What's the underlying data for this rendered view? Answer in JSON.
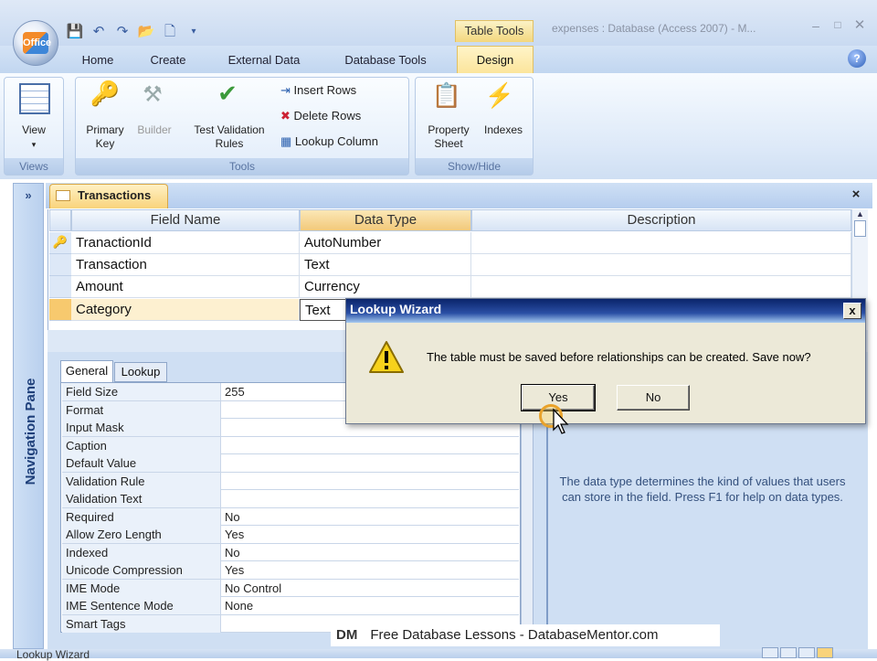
{
  "window": {
    "title": "expenses : Database (Access 2007) - M...",
    "context_tab_group": "Table Tools"
  },
  "office_button": {
    "logo": "Office"
  },
  "quick_access": [
    "save-icon",
    "undo-icon",
    "redo-icon",
    "open-icon",
    "new-icon",
    "customize-icon"
  ],
  "ribbon_tabs": [
    "Home",
    "Create",
    "External Data",
    "Database Tools",
    "Design"
  ],
  "ribbon": {
    "views": {
      "view_label": "View",
      "group_label": "Views"
    },
    "tools": {
      "primary_key": "Primary Key",
      "builder": "Builder",
      "test_validation": "Test Validation Rules",
      "insert_rows": "Insert Rows",
      "delete_rows": "Delete Rows",
      "lookup_column": "Lookup Column",
      "group_label": "Tools"
    },
    "showhide": {
      "property_sheet": "Property Sheet",
      "indexes": "Indexes",
      "group_label": "Show/Hide"
    }
  },
  "nav_pane": {
    "label": "Navigation Pane",
    "chevron": "»"
  },
  "document_tab": {
    "label": "Transactions",
    "close": "×"
  },
  "grid": {
    "headers": [
      "Field Name",
      "Data Type",
      "Description"
    ],
    "rows": [
      {
        "field": "TranactionId",
        "type": "AutoNumber",
        "key": true
      },
      {
        "field": "Transaction",
        "type": "Text",
        "key": false
      },
      {
        "field": "Amount",
        "type": "Currency",
        "key": false
      },
      {
        "field": "Category",
        "type": "Text",
        "key": false
      }
    ]
  },
  "field_properties": {
    "tabs": [
      "General",
      "Lookup"
    ],
    "rows": [
      {
        "name": "Field Size",
        "value": "255"
      },
      {
        "name": "Format",
        "value": ""
      },
      {
        "name": "Input Mask",
        "value": ""
      },
      {
        "name": "Caption",
        "value": ""
      },
      {
        "name": "Default Value",
        "value": ""
      },
      {
        "name": "Validation Rule",
        "value": ""
      },
      {
        "name": "Validation Text",
        "value": ""
      },
      {
        "name": "Required",
        "value": "No"
      },
      {
        "name": "Allow Zero Length",
        "value": "Yes"
      },
      {
        "name": "Indexed",
        "value": "No"
      },
      {
        "name": "Unicode Compression",
        "value": "Yes"
      },
      {
        "name": "IME Mode",
        "value": "No Control"
      },
      {
        "name": "IME Sentence Mode",
        "value": "None"
      },
      {
        "name": "Smart Tags",
        "value": ""
      }
    ],
    "help_text": "The data type determines the kind of values that users can store in the field.  Press F1 for help on data types."
  },
  "dialog": {
    "title": "Lookup Wizard",
    "message": "The table must be saved before relationships can be created.  Save now?",
    "yes_label": "Yes",
    "no_label": "No",
    "close": "x"
  },
  "watermark": {
    "logo": "DM",
    "text": "Free Database Lessons - DatabaseMentor.com"
  },
  "status_bar": {
    "text": "Lookup Wizard"
  },
  "colors": {
    "ribbon_blue": "#c1d6f0",
    "context_yellow": "#f9d37b",
    "dialog_title": "#0a246a"
  }
}
